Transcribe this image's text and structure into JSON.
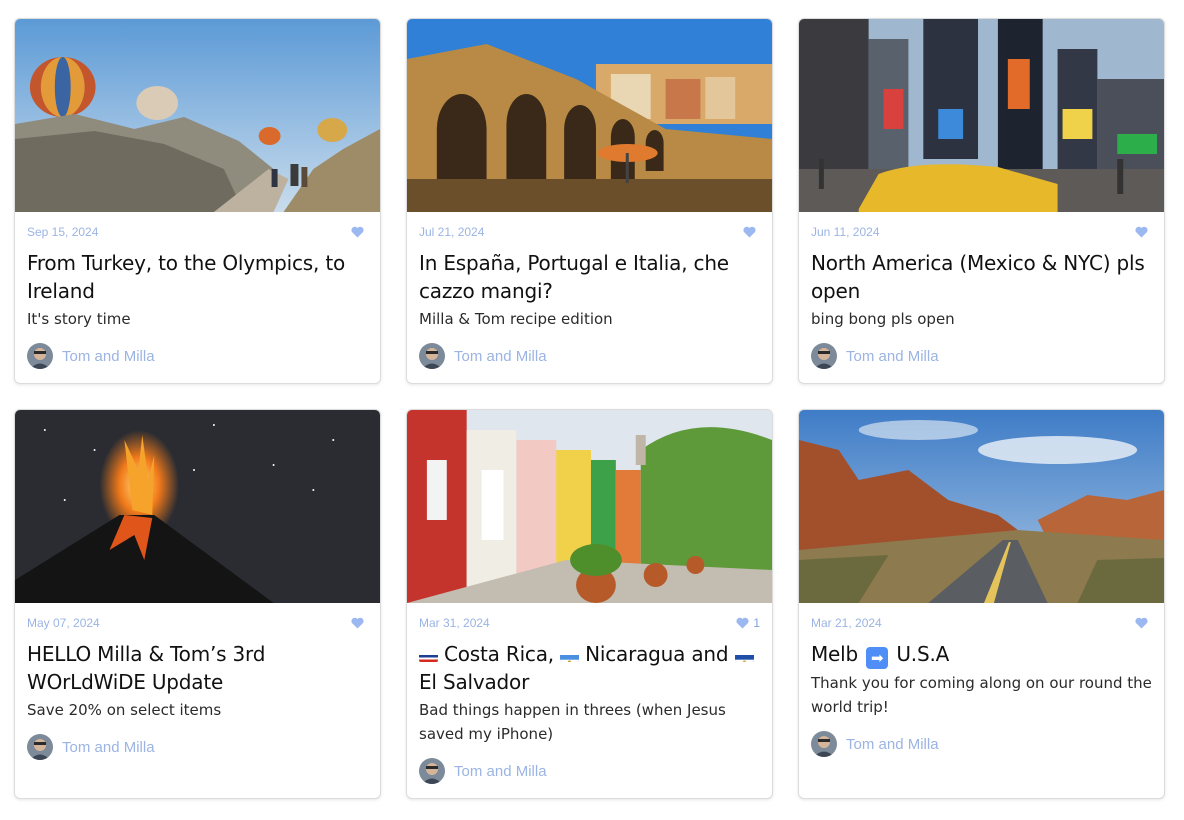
{
  "colors": {
    "accent": "#9bb4e3",
    "heart": "#9bb8f0",
    "card_border": "#dcdcdc",
    "title": "#111111",
    "body_text": "#2b2b2b"
  },
  "posts": [
    {
      "image": "hot-air-balloons-cappadocia",
      "date": "Sep 15, 2024",
      "likes": "",
      "title": "From Turkey, to the Olympics, to Ireland",
      "subtitle": "It's story time",
      "author": "Tom and Milla"
    },
    {
      "image": "stone-arches-aqueduct-town",
      "date": "Jul 21, 2024",
      "likes": "",
      "title": "In España, Portugal e Italia, che cazzo mangi?",
      "subtitle": "Milla & Tom recipe edition",
      "author": "Tom and Milla"
    },
    {
      "image": "times-square-taxi",
      "date": "Jun 11, 2024",
      "likes": "",
      "title": "North America (Mexico & NYC) pls open",
      "subtitle": "bing bong pls open",
      "author": "Tom and Milla"
    },
    {
      "image": "erupting-volcano-night",
      "date": "May 07, 2024",
      "likes": "",
      "title": "HELLO Milla & Tom’s 3rd WOrLdWiDE Update",
      "subtitle": "Save 20% on select items",
      "author": "Tom and Milla"
    },
    {
      "image": "colorful-colonial-street",
      "date": "Mar 31, 2024",
      "likes": "1",
      "title_parts": {
        "flag1": "costa-rica-flag",
        "text1": "Costa Rica,",
        "flag2": "nicaragua-flag",
        "text2": "Nicaragua and",
        "flag3": "el-salvador-flag",
        "text3": "El Salvador"
      },
      "subtitle": "Bad things happen in threes (when Jesus saved my iPhone)",
      "author": "Tom and Milla"
    },
    {
      "image": "desert-canyon-road",
      "date": "Mar 21, 2024",
      "likes": "",
      "title_parts": {
        "text1": "Melb",
        "arrow": "➡",
        "text2": "U.S.A"
      },
      "subtitle": "Thank you for coming along on our round the world trip!",
      "author": "Tom and Milla"
    }
  ]
}
